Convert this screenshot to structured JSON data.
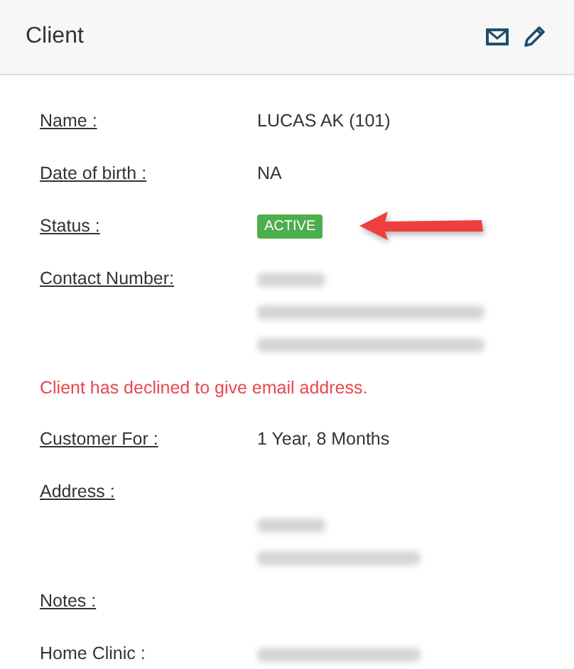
{
  "header": {
    "title": "Client"
  },
  "fields": [
    {
      "label": "Name :",
      "kind": "text",
      "value": "LUCAS AK (101)"
    },
    {
      "label": "Date of birth :",
      "kind": "text",
      "value": "NA"
    },
    {
      "label": "Status :",
      "kind": "badge",
      "value": "ACTIVE",
      "pointer": true
    },
    {
      "label": "Contact Number:",
      "kind": "redacted",
      "lines": [
        {
          "kind": "short"
        },
        {
          "kind": "long"
        },
        {
          "kind": "long"
        }
      ]
    },
    {
      "kind": "notice",
      "value": "Client has declined to give email address."
    },
    {
      "label": "Customer For :",
      "kind": "text",
      "value": "1 Year, 8 Months"
    },
    {
      "label": "Address :",
      "kind": "redacted",
      "lines": [
        {
          "kind": "none"
        },
        {
          "kind": "short"
        },
        {
          "kind": "medium"
        }
      ]
    },
    {
      "label": "Notes :",
      "kind": "empty"
    },
    {
      "label": "Home Clinic :",
      "kind": "redacted",
      "lines": [
        {
          "kind": "medium"
        }
      ],
      "underline": false
    }
  ]
}
